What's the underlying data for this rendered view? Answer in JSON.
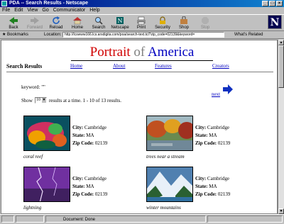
{
  "window": {
    "title": "PDA -- Search Results - Netscape"
  },
  "menu": [
    "File",
    "Edit",
    "View",
    "Go",
    "Communicator",
    "Help"
  ],
  "toolbar": [
    {
      "label": "Back",
      "icon": "back-arrow-icon",
      "enabled": true
    },
    {
      "label": "Forward",
      "icon": "forward-arrow-icon",
      "enabled": false
    },
    {
      "label": "Reload",
      "icon": "reload-icon",
      "enabled": true
    },
    {
      "label": "Home",
      "icon": "home-icon",
      "enabled": true
    },
    {
      "label": "Search",
      "icon": "search-icon",
      "enabled": true
    },
    {
      "label": "Netscape",
      "icon": "netscape-icon",
      "enabled": true
    },
    {
      "label": "Print",
      "icon": "print-icon",
      "enabled": true
    },
    {
      "label": "Security",
      "icon": "security-lock-icon",
      "enabled": true
    },
    {
      "label": "Shop",
      "icon": "shop-bag-icon",
      "enabled": true
    },
    {
      "label": "Stop",
      "icon": "stop-icon",
      "enabled": false
    }
  ],
  "location": {
    "bookmarks_label": "Bookmarks",
    "location_label": "Location:",
    "url": "http://lcswww166.lcs.arsdigita.com/poa/search-text.tcl?zip_code=02139&keyword=",
    "related_label": "What's Related"
  },
  "page": {
    "banner": {
      "word1": "Portrait",
      "word2": "of",
      "word3": "America"
    },
    "heading": "Search Results",
    "nav": [
      "Home",
      "About",
      "Features",
      "Creators"
    ],
    "keyword_line": "keyword: \"\"",
    "next_label": "next",
    "show_prefix": "Show",
    "show_value": "10",
    "show_suffix": "results at a time.  1 - 10 of 13 results."
  },
  "results": [
    {
      "caption": "coral reef",
      "city_label": "City:",
      "city": "Cambridge",
      "state_label": "State:",
      "state": "MA",
      "zip_label": "Zip Code:",
      "zip": "02139"
    },
    {
      "caption": "trees near a stream",
      "city_label": "City:",
      "city": "Cambridge",
      "state_label": "State:",
      "state": "MA",
      "zip_label": "Zip Code:",
      "zip": "02139"
    },
    {
      "caption": "lightning",
      "city_label": "City:",
      "city": "Cambridge",
      "state_label": "State:",
      "state": "MA",
      "zip_label": "Zip Code:",
      "zip": "02139"
    },
    {
      "caption": "winter mountains",
      "city_label": "City:",
      "city": "Cambridge",
      "state_label": "State:",
      "state": "MA",
      "zip_label": "Zip Code:",
      "zip": "02139"
    }
  ],
  "status": {
    "text": "Document: Done"
  },
  "colors": {
    "titlebar": "#000080",
    "link": "#0000c0",
    "banner_red": "#d00000",
    "banner_gray": "#808080",
    "banner_blue": "#0000c0"
  }
}
